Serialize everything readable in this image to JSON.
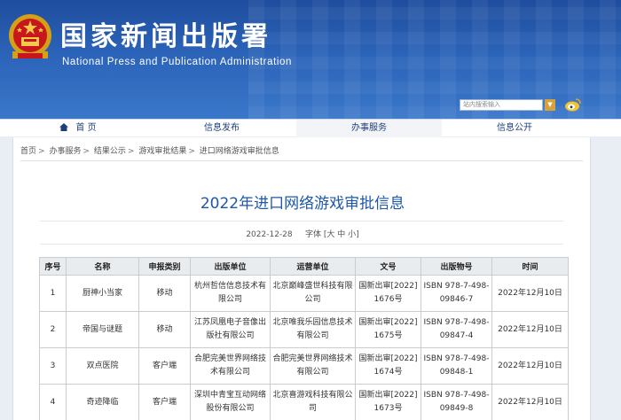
{
  "header": {
    "site_title": "国家新闻出版署",
    "site_subtitle": "National Press and Publication Administration",
    "search_placeholder": "站内搜索输入",
    "search_select": "▼",
    "brand_color": "#2b63b8"
  },
  "nav": {
    "home": "首 页",
    "news": "信息发布",
    "service": "办事服务",
    "public": "信息公开"
  },
  "breadcrumb": [
    "首页",
    "办事服务",
    "结果公示",
    "游戏审批结果",
    "进口网络游戏审批信息"
  ],
  "article": {
    "title": "2022年进口网络游戏审批信息",
    "date": "2022-12-28",
    "font_label": "字体",
    "font_sizes": [
      "大",
      "中",
      "小"
    ]
  },
  "table": {
    "headers": [
      "序号",
      "名称",
      "申报类别",
      "出版单位",
      "运营单位",
      "文号",
      "出版物号",
      "时间"
    ],
    "rows": [
      [
        "1",
        "厨神小当家",
        "移动",
        "杭州哲信信息技术有限公司",
        "北京巅峰盛世科技有限公司",
        "国新出审[2022]1676号",
        "ISBN 978-7-498-09846-7",
        "2022年12月10日"
      ],
      [
        "2",
        "帝国与谜题",
        "移动",
        "江苏凤凰电子音像出版社有限公司",
        "北京唯我乐园信息技术有限公司",
        "国新出审[2022]1675号",
        "ISBN 978-7-498-09847-4",
        "2022年12月10日"
      ],
      [
        "3",
        "双点医院",
        "客户端",
        "合肥完美世界网络技术有限公司",
        "合肥完美世界网络技术有限公司",
        "国新出审[2022]1674号",
        "ISBN 978-7-498-09848-1",
        "2022年12月10日"
      ],
      [
        "4",
        "奇迹降临",
        "客户端",
        "深圳中青宝互动网络股份有限公司",
        "北京喜游戏科技有限公司",
        "国新出审[2022]1673号",
        "ISBN 978-7-498-09849-8",
        "2022年12月10日"
      ]
    ]
  }
}
